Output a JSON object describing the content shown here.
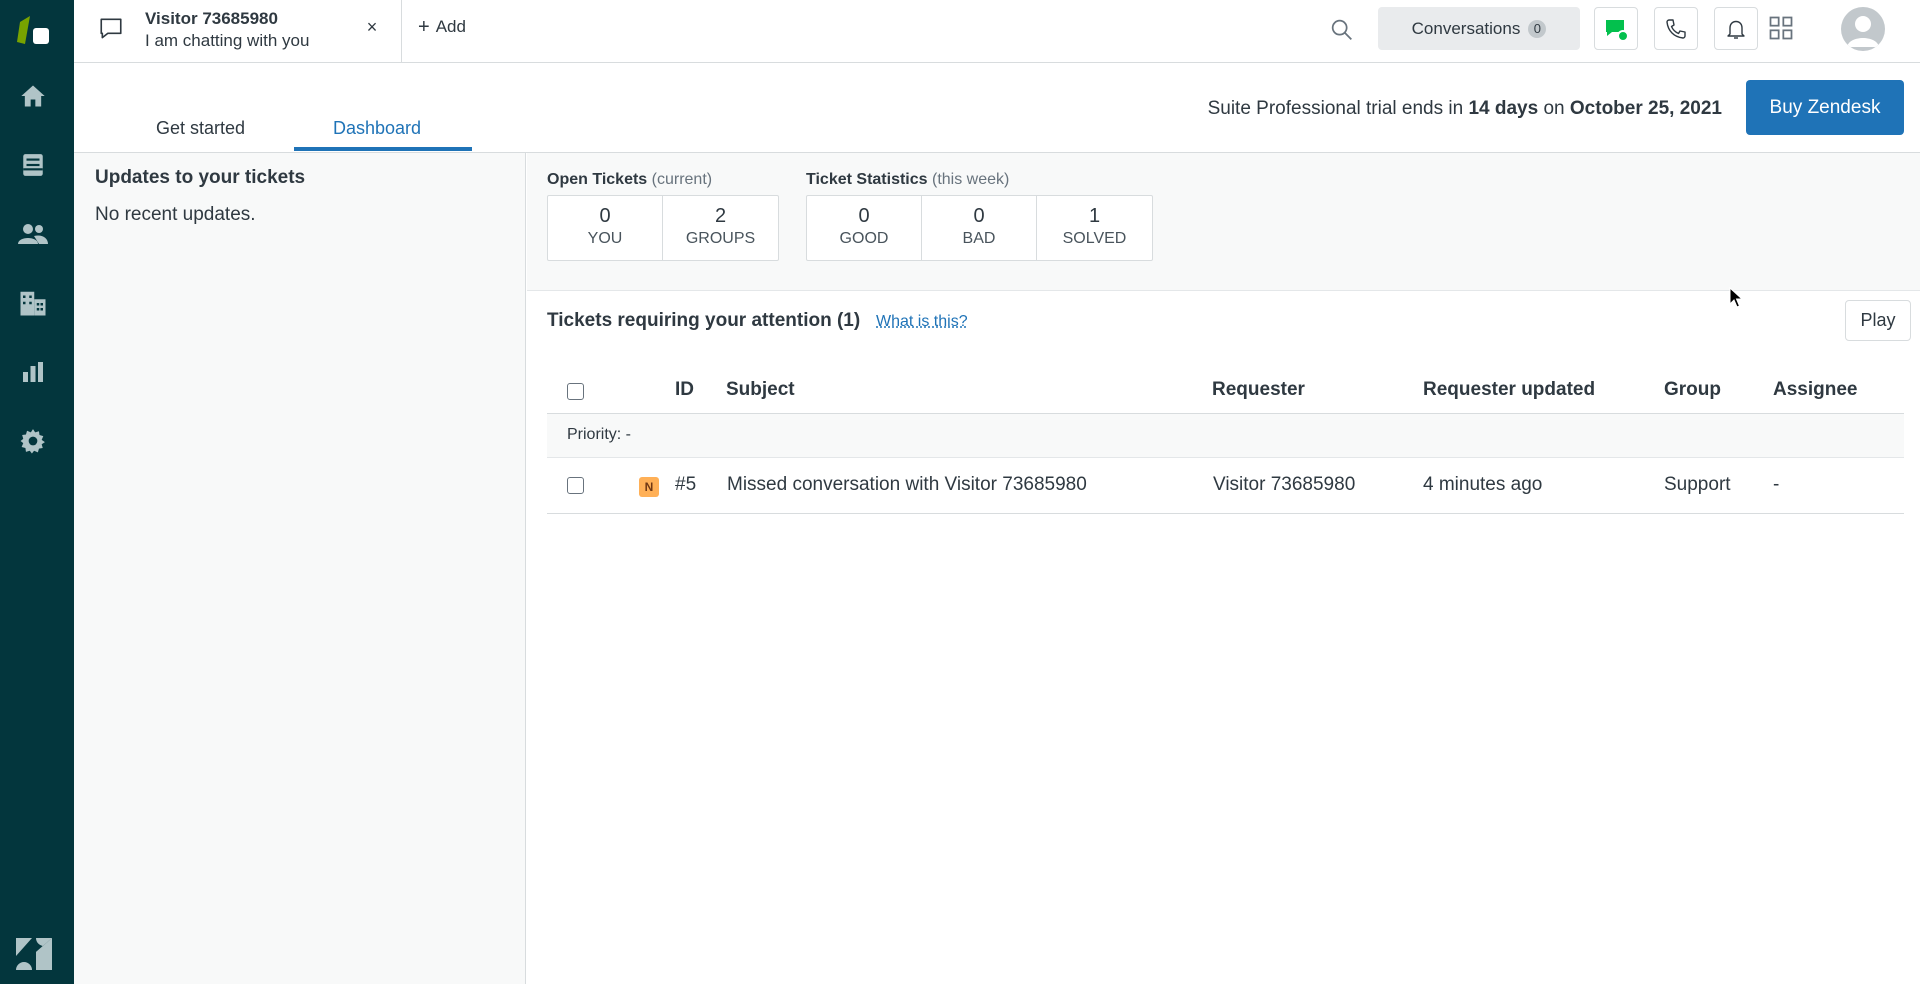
{
  "top_tab": {
    "title": "Visitor 73685980",
    "subtitle": "I am chatting with you",
    "close": "×"
  },
  "add_label": "Add",
  "conversations": {
    "label": "Conversations",
    "count": "0"
  },
  "tabs": [
    {
      "label": "Get started",
      "active": false
    },
    {
      "label": "Dashboard",
      "active": true
    }
  ],
  "trial": {
    "prefix": "Suite Professional trial ends in ",
    "days": "14 days",
    "middle": " on ",
    "date": "October 25, 2021"
  },
  "buy_label": "Buy Zendesk",
  "updates": {
    "title": "Updates to your tickets",
    "empty": "No recent updates."
  },
  "open_tickets": {
    "title": "Open Tickets",
    "qualifier": "(current)",
    "boxes": [
      {
        "num": "0",
        "label": "YOU"
      },
      {
        "num": "2",
        "label": "GROUPS"
      }
    ]
  },
  "ticket_stats": {
    "title": "Ticket Statistics",
    "qualifier": "(this week)",
    "boxes": [
      {
        "num": "0",
        "label": "GOOD"
      },
      {
        "num": "0",
        "label": "BAD"
      },
      {
        "num": "1",
        "label": "SOLVED"
      }
    ]
  },
  "attention": {
    "title": "Tickets requiring your attention (1)",
    "help_link": "What is this?",
    "play_label": "Play"
  },
  "table": {
    "headers": [
      "ID",
      "Subject",
      "Requester",
      "Requester updated",
      "Group",
      "Assignee"
    ],
    "priority_group": "Priority: -",
    "rows": [
      {
        "status": "N",
        "id": "#5",
        "subject": "Missed conversation with Visitor 73685980",
        "requester": "Visitor 73685980",
        "updated": "4 minutes ago",
        "group": "Support",
        "assignee": "-"
      }
    ]
  },
  "colors": {
    "nav_bg": "#03363d",
    "accent": "#1f73b7",
    "chat_online": "#03c04d",
    "new_badge": "#ffb057"
  },
  "icons": [
    "zendesk-support-logo",
    "home-icon",
    "views-icon",
    "customers-icon",
    "organizations-icon",
    "reporting-icon",
    "admin-gear-icon",
    "zendesk-logo",
    "chat-bubble-icon",
    "close-icon",
    "plus-icon",
    "search-icon",
    "chat-status-icon",
    "phone-icon",
    "bell-icon",
    "apps-grid-icon",
    "avatar-icon"
  ]
}
